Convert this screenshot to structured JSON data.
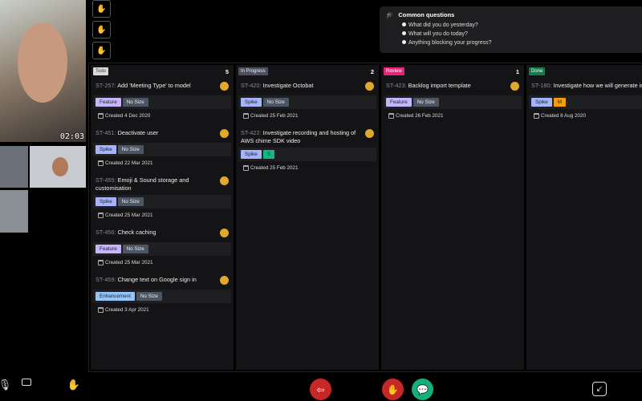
{
  "video": {
    "timer": "02:03"
  },
  "common_questions": {
    "title": "Common questions",
    "items": [
      "What did you do yesterday?",
      "What will you do today?",
      "Anything blocking your progress?"
    ]
  },
  "columns": [
    {
      "label": "Todo",
      "count": "5",
      "color": "#d9d9d9",
      "text_color": "#444",
      "cards": [
        {
          "id": "ST-257:",
          "title": "Add 'Meeting Type' to model",
          "type": "Feature",
          "size": "No Size",
          "created": "Created 4 Dec 2020"
        },
        {
          "id": "ST-451:",
          "title": "Deactivate user",
          "type": "Spike",
          "size": "No Size",
          "created": "Created 22 Mar 2021"
        },
        {
          "id": "ST-455:",
          "title": "Emoji & Sound storage and customisation",
          "type": "Spike",
          "size": "No Size",
          "created": "Created 25 Mar 2021"
        },
        {
          "id": "ST-456:",
          "title": "Check caching",
          "type": "Feature",
          "size": "No Size",
          "created": "Created 25 Mar 2021"
        },
        {
          "id": "ST-459:",
          "title": "Change text on Google sign in",
          "type": "Enhancement",
          "size": "No Size",
          "created": "Created 3 Apr 2021"
        }
      ]
    },
    {
      "label": "In Progress",
      "count": "2",
      "color": "#4a5060",
      "text_color": "#eee",
      "cards": [
        {
          "id": "ST-420:",
          "title": "Investigate Octobat",
          "type": "Spike",
          "size": "No Size",
          "created": "Created 25 Feb 2021"
        },
        {
          "id": "ST-422:",
          "title": "Investigate recording and hosting of AWS chime SDK video",
          "type": "Spike",
          "size": "S",
          "created": "Created 25 Feb 2021"
        }
      ]
    },
    {
      "label": "Review",
      "count": "1",
      "color": "#e0287a",
      "text_color": "#fff",
      "cards": [
        {
          "id": "ST-423:",
          "title": "Backlog import template",
          "type": "Feature",
          "size": "No Size",
          "created": "Created 26 Feb 2021"
        }
      ]
    },
    {
      "label": "Done",
      "count": "",
      "color": "#167a4e",
      "text_color": "#fff",
      "cards": [
        {
          "id": "ST-180:",
          "title": "Investigate how we will generate inv",
          "type": "Spike",
          "size": "M",
          "created": "Created 8 Aug 2020"
        }
      ]
    }
  ],
  "tag_colors": {
    "Feature": "#c4b5fd",
    "Spike": "#a5b4fc",
    "Enhancement": "#93c5fd",
    "No Size": "#4b5563",
    "S": "#10b981",
    "M": "#f59e0b"
  }
}
